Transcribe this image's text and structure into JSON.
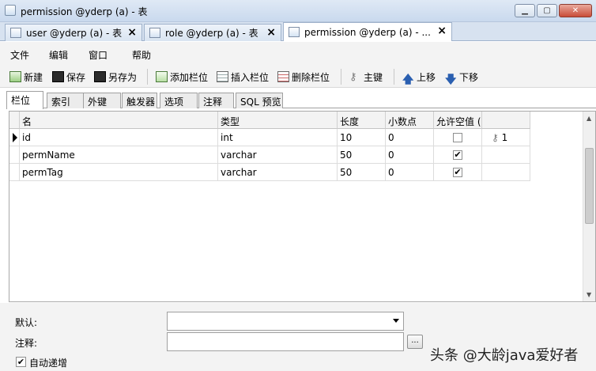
{
  "window": {
    "title": "permission @yderp (a) - 表"
  },
  "doc_tabs": [
    {
      "label": "user @yderp (a) - 表"
    },
    {
      "label": "role @yderp (a) - 表"
    },
    {
      "label": "permission @yderp (a) - ..."
    }
  ],
  "menu": {
    "file": "文件",
    "edit": "编辑",
    "window": "窗口",
    "help": "帮助"
  },
  "toolbar": {
    "new": "新建",
    "save": "保存",
    "save_as": "另存为",
    "add_field": "添加栏位",
    "insert_field": "插入栏位",
    "delete_field": "删除栏位",
    "primary_key": "主键",
    "move_up": "上移",
    "move_down": "下移"
  },
  "sub_tabs": [
    "栏位",
    "索引",
    "外键",
    "触发器",
    "选项",
    "注释",
    "SQL 预览"
  ],
  "grid": {
    "headers": [
      "名",
      "类型",
      "长度",
      "小数点",
      "允许空值 ("
    ],
    "rows": [
      {
        "name": "id",
        "type": "int",
        "length": "10",
        "decimals": "0",
        "allow_null": false,
        "key": "1"
      },
      {
        "name": "permName",
        "type": "varchar",
        "length": "50",
        "decimals": "0",
        "allow_null": true,
        "key": ""
      },
      {
        "name": "permTag",
        "type": "varchar",
        "length": "50",
        "decimals": "0",
        "allow_null": true,
        "key": ""
      }
    ]
  },
  "properties": {
    "default_label": "默认:",
    "default_value": "",
    "comment_label": "注释:",
    "comment_value": "",
    "browse_button": "...",
    "auto_increment_label": "自动递增",
    "auto_increment_checked": true
  },
  "watermark": "头条 @大龄java爱好者",
  "icons": {
    "key": "key-icon",
    "checkmark": "✔"
  }
}
